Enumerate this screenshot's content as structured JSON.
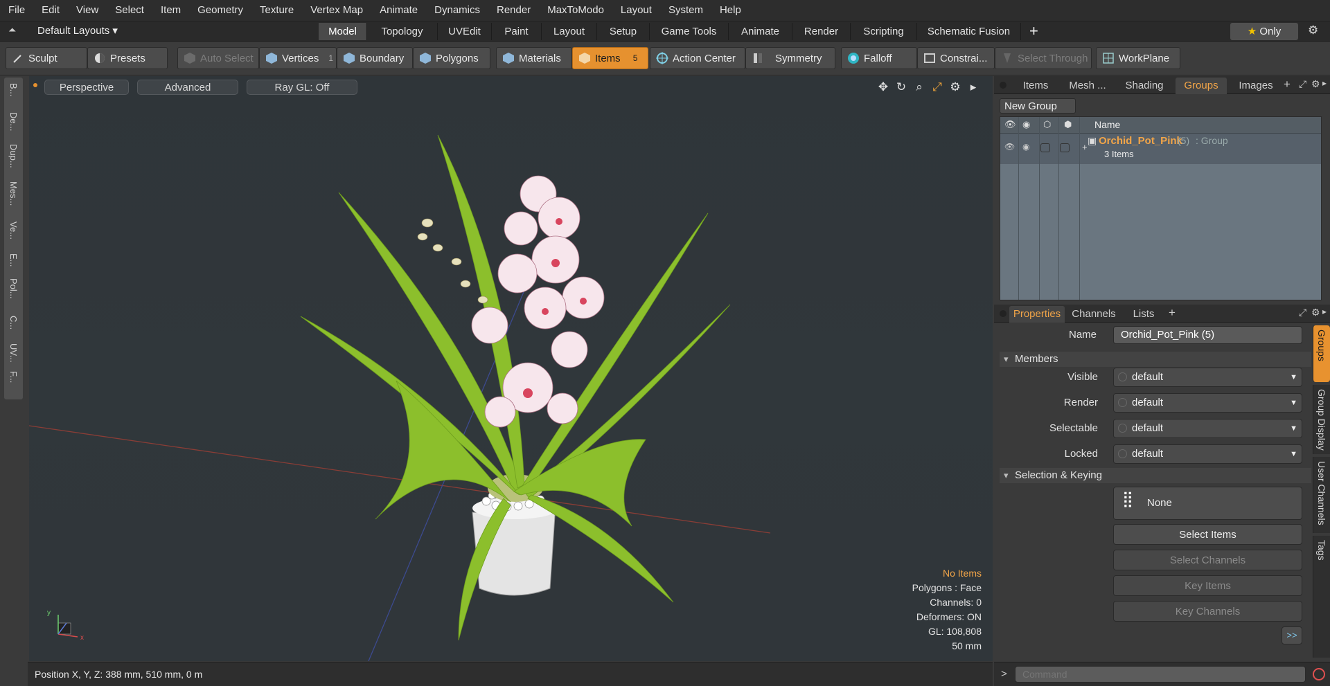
{
  "menu": [
    "File",
    "Edit",
    "View",
    "Select",
    "Item",
    "Geometry",
    "Texture",
    "Vertex Map",
    "Animate",
    "Dynamics",
    "Render",
    "MaxToModo",
    "Layout",
    "System",
    "Help"
  ],
  "layout_bar": {
    "layout_name": "Default Layouts",
    "tabs": [
      "Model",
      "Topology",
      "UVEdit",
      "Paint",
      "Layout",
      "Setup",
      "Game Tools",
      "Animate",
      "Render",
      "Scripting",
      "Schematic Fusion"
    ],
    "active_tab": "Model",
    "add": "+",
    "only_label": "Only",
    "star": "★"
  },
  "toolbar": {
    "sculpt": "Sculpt",
    "presets": "Presets",
    "auto_select": "Auto Select",
    "vertices": "Vertices",
    "vertices_count": "1",
    "boundary": "Boundary",
    "polygons": "Polygons",
    "materials": "Materials",
    "items": "Items",
    "items_count": "5",
    "action_center": "Action Center",
    "symmetry": "Symmetry",
    "falloff": "Falloff",
    "constraints": "Constrai...",
    "select_through": "Select Through",
    "workplane": "WorkPlane"
  },
  "left_tabs": [
    "B...",
    "De...",
    "Dup...",
    "Mes...",
    "Ve...",
    "E...",
    "Pol...",
    "C...",
    "UV...",
    "F..."
  ],
  "viewport": {
    "perspective": "Perspective",
    "advanced": "Advanced",
    "raygl": "Ray GL: Off",
    "info": {
      "items": "No Items",
      "polygons": "Polygons : Face",
      "channels": "Channels: 0",
      "deformers": "Deformers: ON",
      "gl": "GL: 108,808",
      "scale": "50 mm"
    },
    "axis_y": "y",
    "axis_x": "x"
  },
  "status": {
    "position": "Position X, Y, Z:   388 mm, 510 mm, 0 m"
  },
  "groups_panel": {
    "tabs": [
      "Items",
      "Mesh ...",
      "Shading",
      "Groups",
      "Images"
    ],
    "active_tab": "Groups",
    "add": "+",
    "new_group": "New Group",
    "col_name": "Name",
    "row": {
      "name": "Orchid_Pot_Pink",
      "count": "(5)",
      "type": ": Group",
      "sub": "3 Items",
      "expand": "+"
    }
  },
  "properties_panel": {
    "tabs": [
      "Properties",
      "Channels",
      "Lists"
    ],
    "active_tab": "Properties",
    "add": "+",
    "name_label": "Name",
    "name_value": "Orchid_Pot_Pink (5)",
    "members_section": "Members",
    "fields": [
      {
        "label": "Visible",
        "value": "default"
      },
      {
        "label": "Render",
        "value": "default"
      },
      {
        "label": "Selectable",
        "value": "default"
      },
      {
        "label": "Locked",
        "value": "default"
      }
    ],
    "selection_section": "Selection & Keying",
    "none_label": "None",
    "select_items": "Select Items",
    "select_channels": "Select Channels",
    "key_items": "Key Items",
    "key_channels": "Key Channels",
    "more": ">>",
    "side_tabs": [
      "Groups",
      "Group Display",
      "User Channels",
      "Tags"
    ]
  },
  "command": {
    "prompt": ">",
    "placeholder": "Command"
  },
  "colors": {
    "accent": "#e8922f",
    "highlight_text": "#f2a548",
    "viewport_bg": "#30363a"
  }
}
